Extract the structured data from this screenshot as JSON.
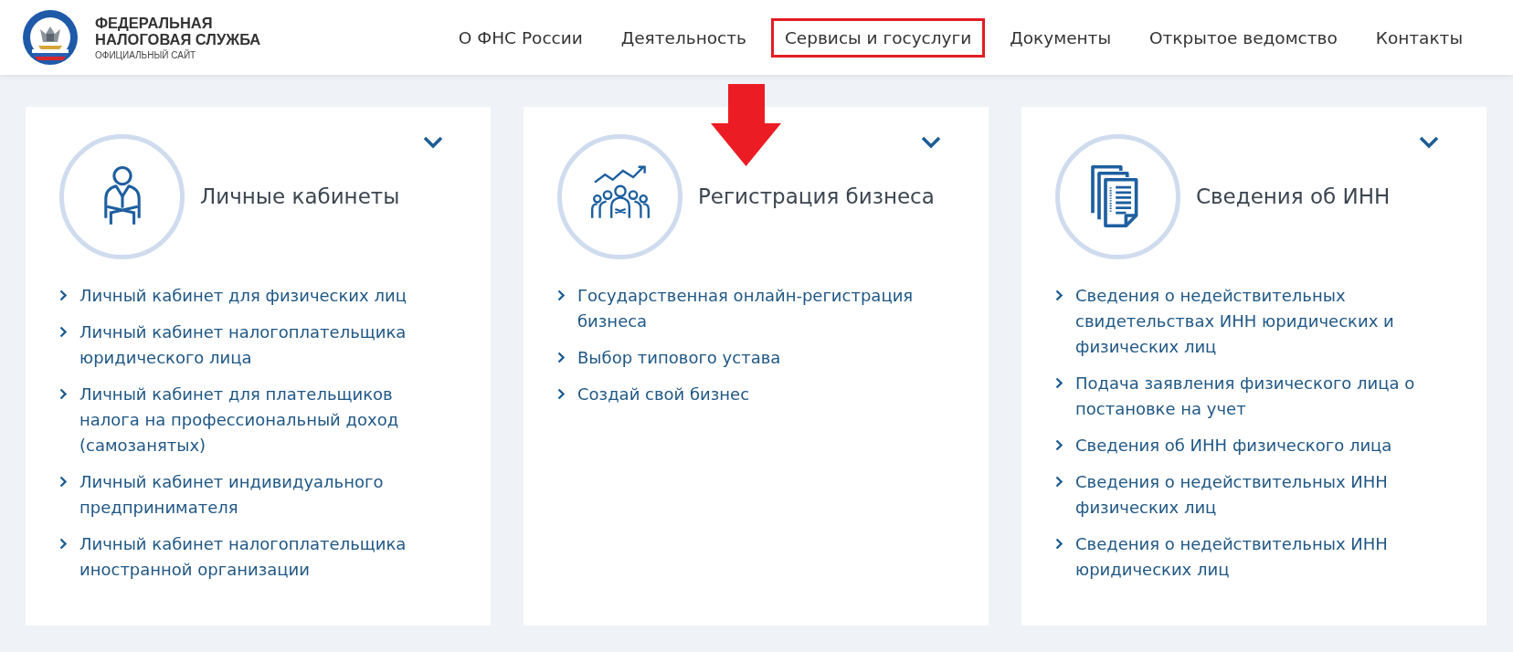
{
  "logo": {
    "title_lines": [
      "ФЕДЕРАЛЬНАЯ",
      "НАЛОГОВАЯ СЛУЖБА"
    ],
    "subtitle": "ОФИЦИАЛЬНЫЙ САЙТ"
  },
  "nav": [
    {
      "label": "О ФНС России",
      "highlighted": false
    },
    {
      "label": "Деятельность",
      "highlighted": false
    },
    {
      "label": "Сервисы и госуслуги",
      "highlighted": true
    },
    {
      "label": "Документы",
      "highlighted": false
    },
    {
      "label": "Открытое ведомство",
      "highlighted": false
    },
    {
      "label": "Контакты",
      "highlighted": false
    }
  ],
  "cards": [
    {
      "title": "Личные кабинеты",
      "kind": "person",
      "links": [
        "Личный кабинет для физических лиц",
        "Личный кабинет налогоплательщика юридического лица",
        "Личный кабинет для плательщиков налога на профессиональный доход (самозанятых)",
        "Личный кабинет индивидуального предпринимателя",
        "Личный кабинет налогоплательщика иностранной организации"
      ]
    },
    {
      "title": "Регистрация бизнеса",
      "kind": "team",
      "links": [
        "Государственная онлайн-регистрация бизнеса",
        "Выбор типового устава",
        "Создай свой бизнес"
      ]
    },
    {
      "title": "Сведения об ИНН",
      "kind": "documents",
      "links": [
        "Сведения о недействительных свидетельствах ИНН юридических и физических лиц",
        "Подача заявления физического лица о постановке на учет",
        "Сведения об ИНН физического лица",
        "Сведения о недействительных ИНН физических лиц",
        "Сведения о недействительных ИНН юридических лиц"
      ]
    }
  ]
}
